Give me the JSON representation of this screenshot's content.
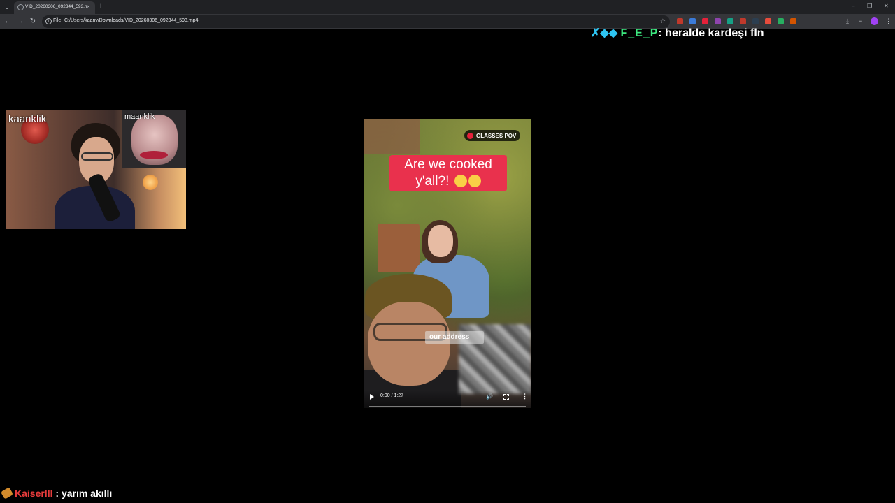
{
  "browser": {
    "tab_title": "VID_20260306_092344_593.mp4",
    "tab_close": "×",
    "new_tab": "+",
    "tab_menu": "⌄",
    "minimize": "–",
    "restore": "❐",
    "close": "✕",
    "back": "←",
    "forward": "→",
    "reload": "↻",
    "scheme_label": "File",
    "url": "C:/Users/kaanv/Downloads/VID_20260306_092344_593.mp4",
    "bookmark": "☆",
    "download": "⤓",
    "extensions": [
      "#c0392b",
      "#3b7bd9",
      "#e5213a",
      "#8e44ad",
      "#16a085",
      "#c0392b",
      "#2c3e50",
      "#e74c3c",
      "#27ae60",
      "#d35400"
    ]
  },
  "chat_top": {
    "badges": "✗◆◆",
    "user": "F_E_P",
    "separator": ":",
    "message": "heralde kardeşi fln"
  },
  "chat_bottom": {
    "user": "KaiserIII",
    "separator": ":",
    "message": "yarım akıllı"
  },
  "webcam": {
    "name": "kaanklik",
    "pip_name": "maanklik"
  },
  "video": {
    "badge": "GLASSES POV",
    "caption_line1": "Are we cooked",
    "caption_line2": "y'all?!",
    "address_text": "our address",
    "time": "0:00 / 1:27",
    "volume": "🔊",
    "more": "⋮",
    "progress": 0
  }
}
